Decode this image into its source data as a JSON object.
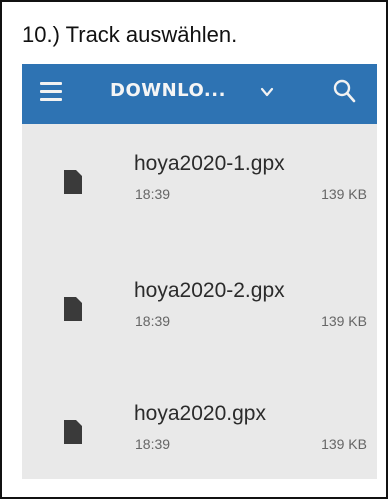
{
  "caption": "10.) Track auswählen.",
  "appbar": {
    "menu_icon": "hamburger-menu-icon",
    "folder_label": "DOWNLO...",
    "dropdown_icon": "chevron-down-icon",
    "search_icon": "search-icon",
    "color": "#2e73b3"
  },
  "files": [
    {
      "name": "hoya2020-1.gpx",
      "time": "18:39",
      "size": "139 KB",
      "icon": "file-icon"
    },
    {
      "name": "hoya2020-2.gpx",
      "time": "18:39",
      "size": "139 KB",
      "icon": "file-icon"
    },
    {
      "name": "hoya2020.gpx",
      "time": "18:39",
      "size": "139 KB",
      "icon": "file-icon"
    }
  ]
}
